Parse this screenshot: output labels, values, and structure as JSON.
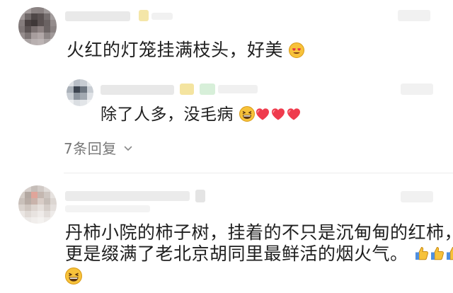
{
  "comments": [
    {
      "text": "火红的灯笼挂满枝头，好美",
      "emoji_suffix": [
        "heart-eyes-emoji"
      ],
      "reply": {
        "text": "除了人多，没毛病",
        "emoji_suffix": [
          "grinning-squint-emoji",
          "red-heart-emoji",
          "red-heart-emoji",
          "red-heart-emoji"
        ]
      },
      "more_replies_label": "7条回复"
    },
    {
      "text_line1": "丹柿小院的柿子树，挂着的不只是沉甸甸的红柿，",
      "text_line2": "更是缀满了老北京胡同里最鲜活的烟火气。",
      "emoji_suffix": [
        "thumbs-up-emoji",
        "thumbs-up-emoji",
        "thumbs-up-emoji",
        "grinning-squint-emoji"
      ]
    }
  ],
  "colors": {
    "text": "#1f1f1f",
    "muted": "#777777",
    "heart": "#ef3b4d",
    "emoji_yellow": "#f7c23a"
  }
}
